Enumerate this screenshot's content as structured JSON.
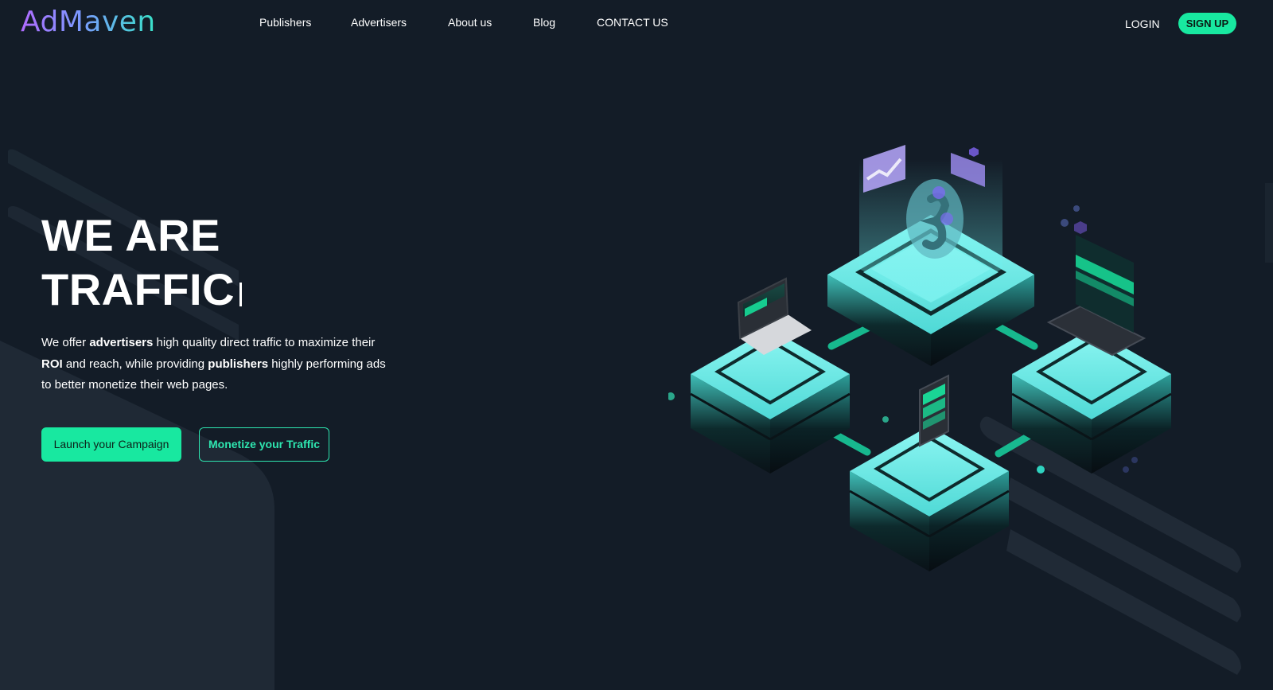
{
  "brand": {
    "logo_text": "AdMaven"
  },
  "nav": {
    "items": [
      {
        "label": "Publishers"
      },
      {
        "label": "Advertisers"
      },
      {
        "label": "About us"
      },
      {
        "label": "Blog"
      },
      {
        "label": "CONTACT US"
      }
    ],
    "login_label": "LOGIN",
    "signup_label": "SIGN UP"
  },
  "hero": {
    "title_line1": "WE ARE",
    "title_line2": "TRAFFIC",
    "desc": {
      "p1": "We offer ",
      "b1": "advertisers",
      "p2": " high quality direct traffic to maximize their ",
      "b2": "ROI",
      "p3": " and reach, while providing ",
      "b3": "publishers",
      "p4": " highly performing ads to better monetize their web pages."
    },
    "cta_primary": "Launch your Campaign",
    "cta_secondary": "Monetize your Traffic"
  },
  "colors": {
    "background": "#131c27",
    "accent_green": "#18e8a0",
    "accent_cyan": "#6ff0ee",
    "logo_gradient": [
      "#b06bff",
      "#7a9bff",
      "#38e2c8"
    ],
    "stripe": "#27313d"
  },
  "illustration": {
    "icon": "isometric-network-illustration"
  }
}
